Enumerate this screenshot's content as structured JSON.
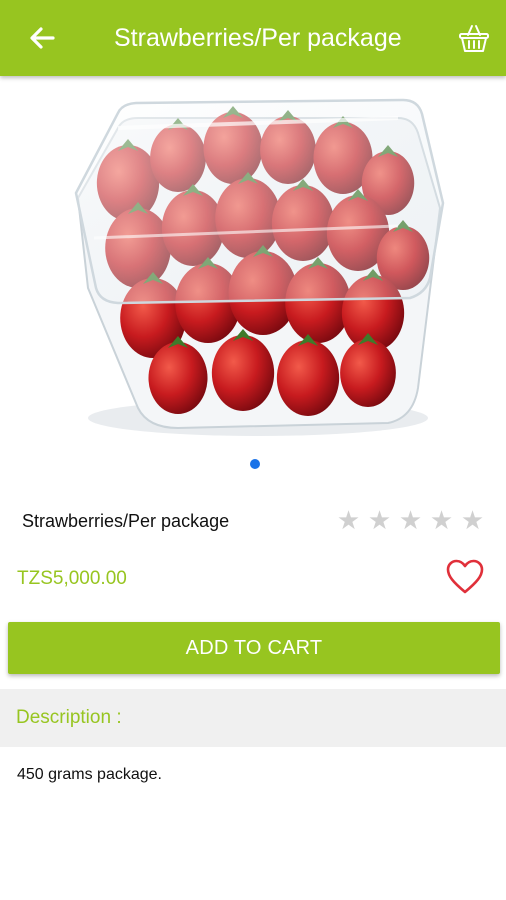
{
  "header": {
    "title": "Strawberries/Per package",
    "back_icon": "arrow-left-icon",
    "cart_icon": "shopping-basket-icon",
    "accent_color": "#97c520"
  },
  "gallery": {
    "image_alt": "Strawberries in a clear plastic clamshell container",
    "page_count": 1,
    "active_index": 0,
    "dot_color": "#1a73e8"
  },
  "product": {
    "name": "Strawberries/Per package",
    "rating": 0,
    "rating_max": 5,
    "price": "TZS5,000.00",
    "price_color": "#97c520",
    "favorite_icon": "heart-outline-icon",
    "favorite_color": "#e0303a"
  },
  "actions": {
    "add_to_cart_label": "ADD TO CART"
  },
  "description": {
    "heading": "Description :",
    "text": "450 grams package."
  }
}
